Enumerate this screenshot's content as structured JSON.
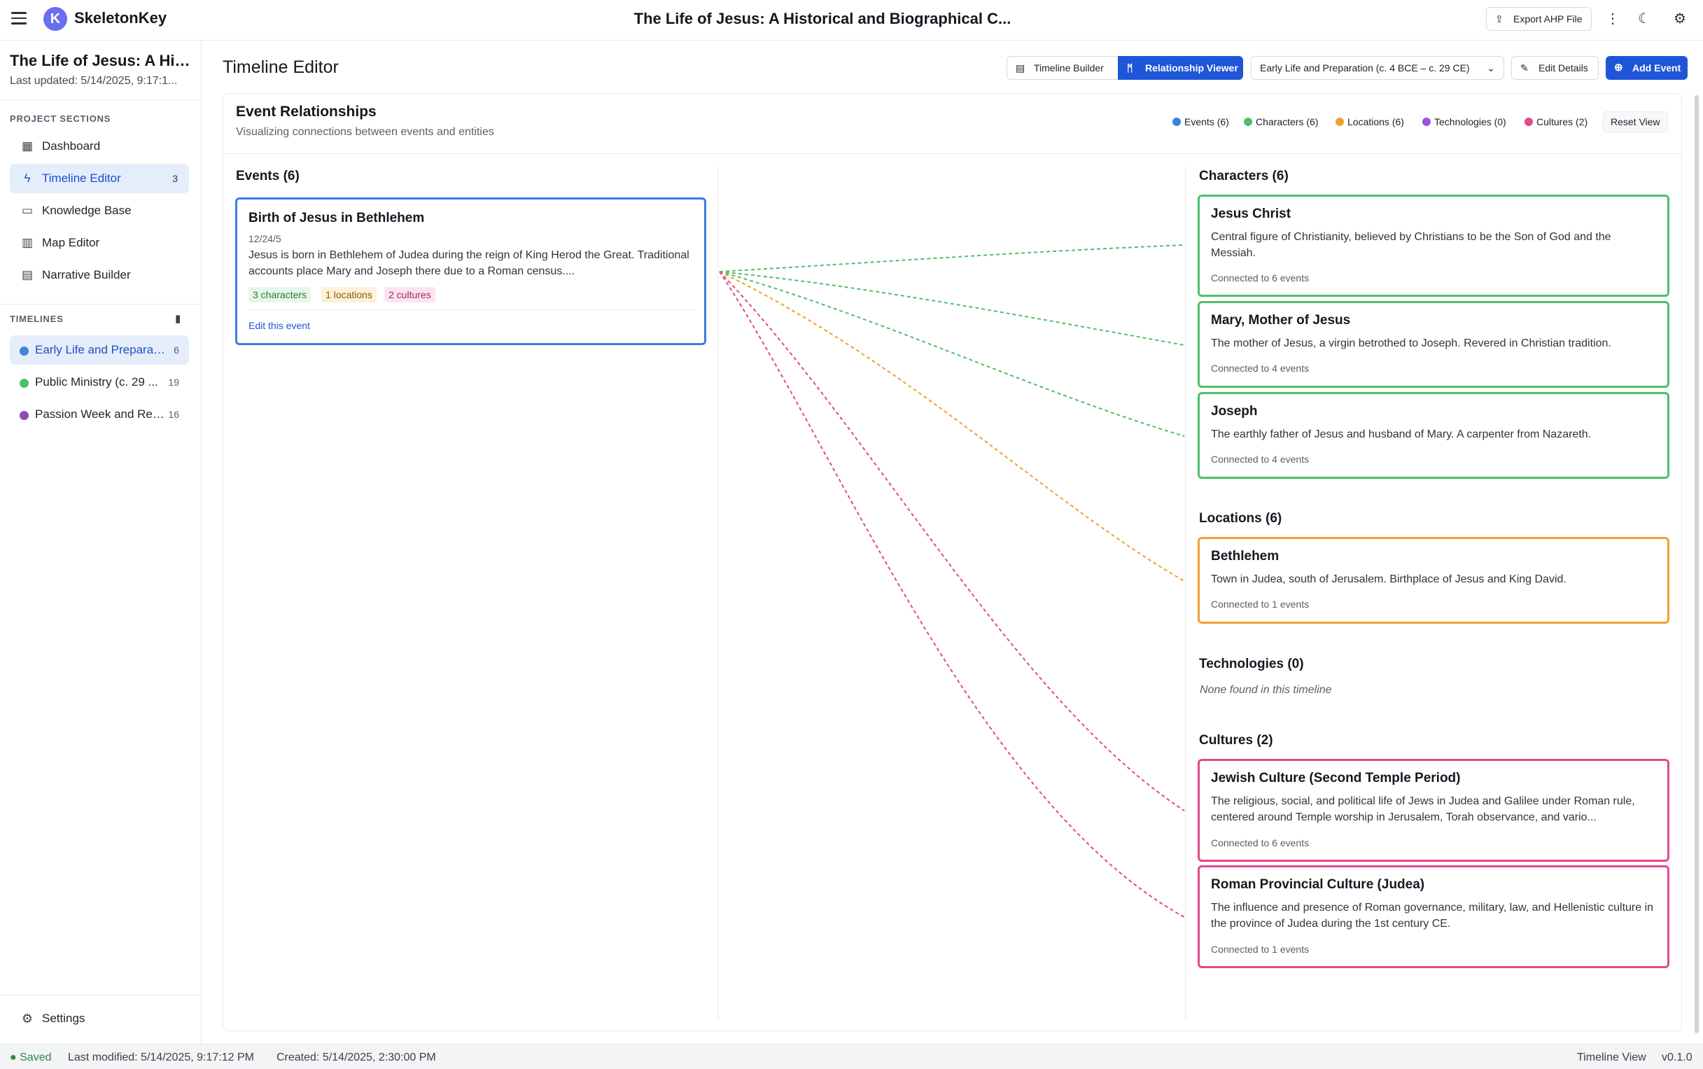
{
  "app": {
    "name": "SkeletonKey",
    "logo_letter": "K",
    "document_title": "The Life of Jesus: A Historical and Biographical C..."
  },
  "toolbar": {
    "export_label": "Export AHP File",
    "more_icon": "more-vertical-icon",
    "theme_icon": "moon-icon",
    "settings_icon": "gear-icon"
  },
  "sidebar": {
    "project_title": "The Life of Jesus: A His...",
    "last_updated": "Last updated: 5/14/2025, 9:17:1...",
    "sections_heading": "PROJECT SECTIONS",
    "items": [
      {
        "label": "Dashboard",
        "icon": "grid-icon"
      },
      {
        "label": "Timeline Editor",
        "icon": "lightning-icon",
        "badge": "3",
        "active": true
      },
      {
        "label": "Knowledge Base",
        "icon": "book-icon"
      },
      {
        "label": "Map Editor",
        "icon": "map-icon"
      },
      {
        "label": "Narrative Builder",
        "icon": "list-icon"
      }
    ],
    "timelines_heading": "TIMELINES",
    "timelines": [
      {
        "label": "Early Life and Preparati...",
        "count": "6",
        "color": "#3d86d9",
        "active": true
      },
      {
        "label": "Public Ministry (c. 29 ...",
        "count": "19",
        "color": "#4fbf6a"
      },
      {
        "label": "Passion Week and Res...",
        "count": "16",
        "color": "#8c4cb8"
      }
    ],
    "settings_label": "Settings"
  },
  "main": {
    "title": "Timeline Editor",
    "view_toggle": {
      "builder_label": "Timeline Builder",
      "viewer_label": "Relationship Viewer",
      "active": "viewer"
    },
    "timeline_select": "Early Life and Preparation (c. 4 BCE – c. 29 CE)",
    "edit_details_label": "Edit Details",
    "add_event_label": "Add Event"
  },
  "relationships": {
    "title": "Event Relationships",
    "subtitle": "Visualizing connections between events and entities",
    "legend": [
      {
        "label": "Events (6)",
        "color": "#3d7fe6"
      },
      {
        "label": "Characters (6)",
        "color": "#4fbf6a"
      },
      {
        "label": "Locations (6)",
        "color": "#f0a032"
      },
      {
        "label": "Technologies (0)",
        "color": "#9b52e0"
      },
      {
        "label": "Cultures (2)",
        "color": "#e0498e"
      }
    ],
    "reset_label": "Reset View",
    "events_heading": "Events (6)",
    "event": {
      "title": "Birth of Jesus in Bethlehem",
      "date": "12/24/5",
      "description": "Jesus is born in Bethlehem of Judea during the reign of King Herod the Great. Traditional accounts place Mary and Joseph there due to a Roman census....",
      "tags": [
        "3 characters",
        "1 locations",
        "2 cultures"
      ],
      "edit_label": "Edit this event"
    },
    "characters_heading": "Characters (6)",
    "characters": [
      {
        "name": "Jesus Christ",
        "description": "Central figure of Christianity, believed by Christians to be the Son of God and the Messiah.",
        "connected": "Connected to 6 events"
      },
      {
        "name": "Mary, Mother of Jesus",
        "description": "The mother of Jesus, a virgin betrothed to Joseph. Revered in Christian tradition.",
        "connected": "Connected to 4 events"
      },
      {
        "name": "Joseph",
        "description": "The earthly father of Jesus and husband of Mary. A carpenter from Nazareth.",
        "connected": "Connected to 4 events"
      }
    ],
    "locations_heading": "Locations (6)",
    "locations": [
      {
        "name": "Bethlehem",
        "description": "Town in Judea, south of Jerusalem. Birthplace of Jesus and King David.",
        "connected": "Connected to 1 events"
      }
    ],
    "technologies_heading": "Technologies (0)",
    "technologies_empty": "None found in this timeline",
    "cultures_heading": "Cultures (2)",
    "cultures": [
      {
        "name": "Jewish Culture (Second Temple Period)",
        "description": "The religious, social, and political life of Jews in Judea and Galilee under Roman rule, centered around Temple worship in Jerusalem, Torah observance, and vario...",
        "connected": "Connected to 6 events"
      },
      {
        "name": "Roman Provincial Culture (Judea)",
        "description": "The influence and presence of Roman governance, military, law, and Hellenistic culture in the province of Judea during the 1st century CE.",
        "connected": "Connected to 1 events"
      }
    ]
  },
  "status": {
    "saved": "Saved",
    "last_modified": "Last modified: 5/14/2025, 9:17:12 PM",
    "created": "Created: 5/14/2025, 2:30:00 PM",
    "view": "Timeline View",
    "version": "v0.1.0"
  }
}
